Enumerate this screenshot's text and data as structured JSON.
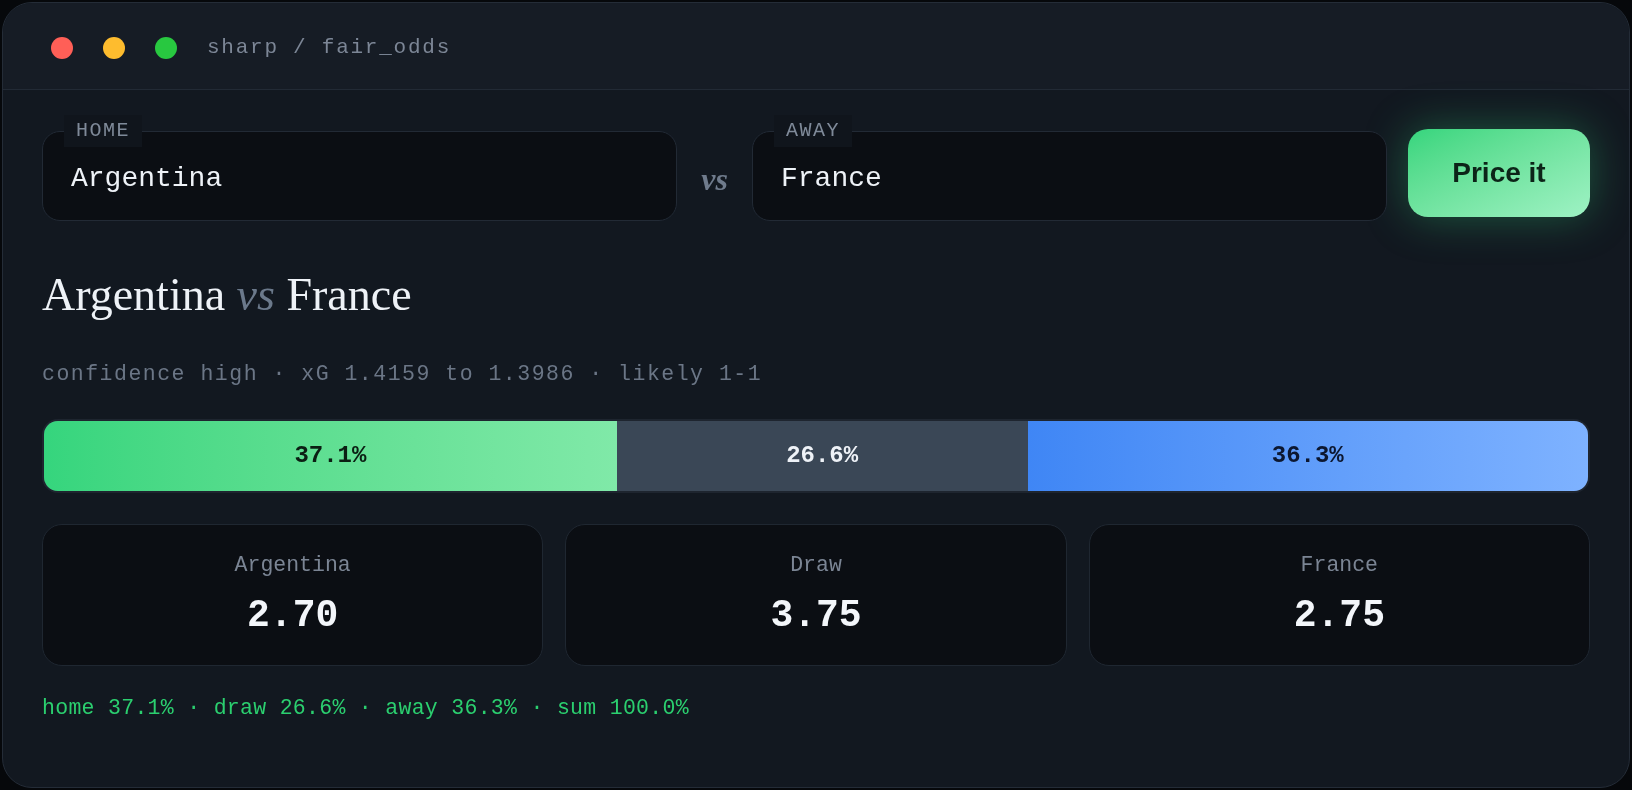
{
  "window": {
    "title": "sharp / fair_odds",
    "controls": [
      {
        "color": "#ff5f57"
      },
      {
        "color": "#febc2e"
      },
      {
        "color": "#28c840"
      }
    ]
  },
  "teams": [
    {
      "label": "HOME",
      "value": "Argentina"
    },
    {
      "label": "AWAY",
      "value": "France"
    }
  ],
  "separator": "vs",
  "price_button": {
    "label": "Price it"
  },
  "match_title": "Argentina *vs* France",
  "summary": "confidence high · xG 1.4159 to 1.3986 · likely 1-1",
  "split_bar": {
    "segments": [
      {
        "kind": "home",
        "label": "37.1%",
        "level": 0.371
      },
      {
        "kind": "draw",
        "label": "26.6%"
      },
      {
        "kind": "away",
        "label": "36.3%",
        "level": 0.363
      }
    ]
  },
  "odds_cards": [
    {
      "label": "Argentina",
      "value": "2.70"
    },
    {
      "label": "Draw",
      "value": "3.75"
    },
    {
      "label": "France",
      "value": "2.75"
    }
  ],
  "footer": "home 37.1% · draw 26.6% · away 36.3% · sum 100.0%"
}
